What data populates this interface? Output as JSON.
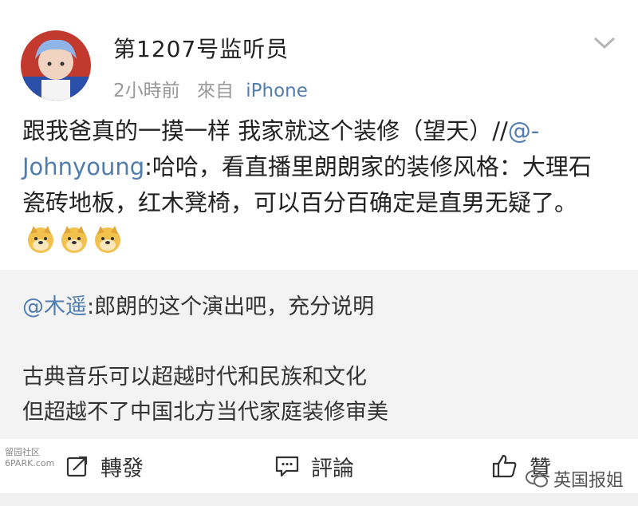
{
  "post": {
    "username": "第1207号监听员",
    "time": "2小時前",
    "from_label": "來自",
    "client": "iPhone",
    "text_main": "跟我爸真的一摸一样 我家就这个装修（望天）//",
    "mention": "@-Johnyoung",
    "text_rest": ":哈哈，看直播里朗朗家的装修风格：大理石瓷砖地板，红木凳椅，可以百分百确定是直男无疑了。",
    "emoji": [
      "doge-emoji",
      "doge-emoji",
      "doge-emoji"
    ]
  },
  "quote": {
    "mention": "@木遥",
    "line1": ":郎朗的这个演出吧，充分说明",
    "line2": "古典音乐可以超越时代和民族和文化",
    "line3": "但超越不了中国北方当代家庭装修审美"
  },
  "actions": {
    "repost": "轉發",
    "comment": "評論",
    "like": "贊"
  },
  "watermarks": {
    "left_top": "留园社区",
    "left_bottom": "6PARK.com",
    "right": "英国报姐"
  },
  "colors": {
    "link": "#507daf",
    "meta": "#999999",
    "text": "#222222"
  }
}
